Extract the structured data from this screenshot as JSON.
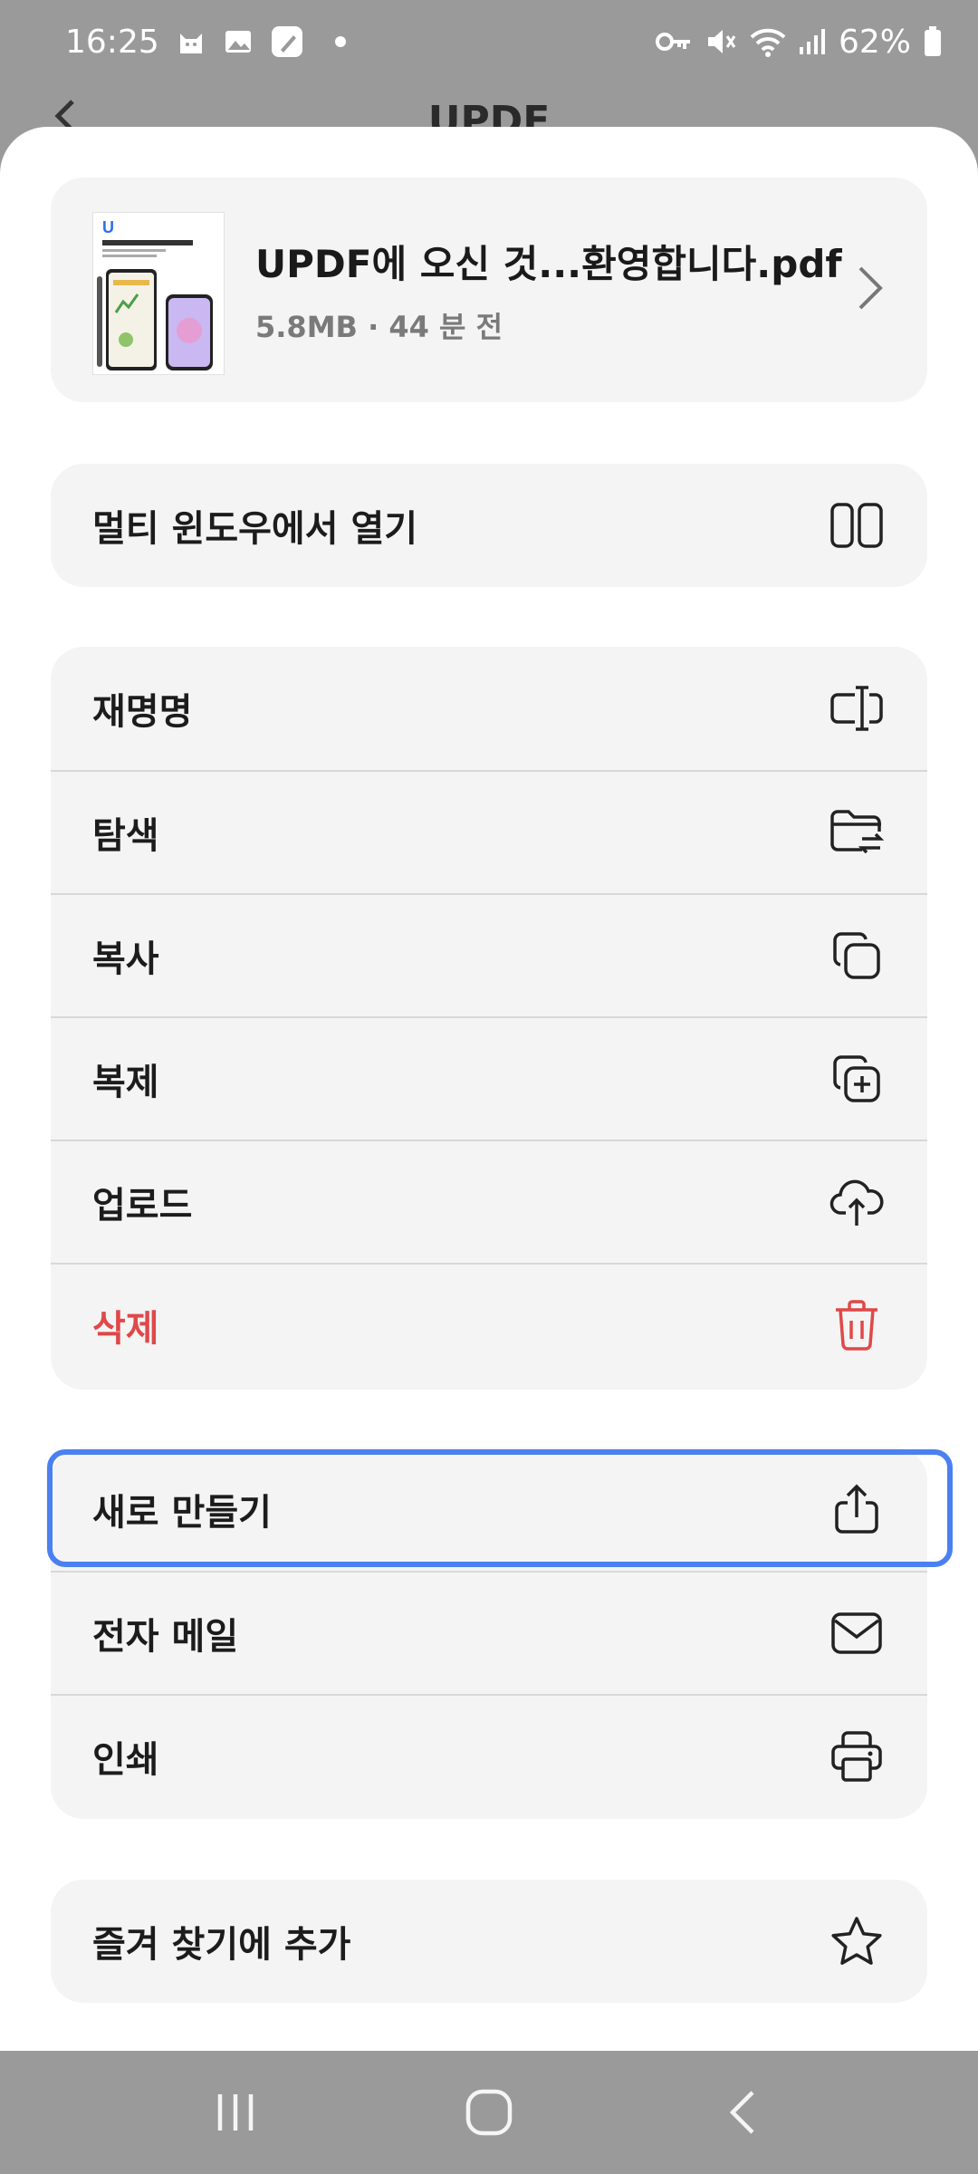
{
  "status_bar": {
    "time": "16:25",
    "battery": "62%",
    "left_icons": [
      "cat-notification-icon",
      "gallery-notification-icon",
      "notes-notification-icon"
    ],
    "right_icons": [
      "vpn-key-icon",
      "mute-icon",
      "wifi-icon",
      "signal-icon",
      "battery-icon"
    ]
  },
  "background_app": {
    "title": "UPDF"
  },
  "file": {
    "name": "UPDF에 오신 것...환영합니다.pdf",
    "size": "5.8MB",
    "separator": "·",
    "time": "44 분 전",
    "thumbnail_logo": "U",
    "thumbnail_title": "UPDF에 오신 것을 환영합니다"
  },
  "multi_window": {
    "label": "멀티 윈도우에서 열기",
    "icon": "multi-window-icon"
  },
  "actions": [
    {
      "label": "재명명",
      "icon": "rename-icon"
    },
    {
      "label": "탐색",
      "icon": "folder-move-icon"
    },
    {
      "label": "복사",
      "icon": "copy-icon"
    },
    {
      "label": "복제",
      "icon": "duplicate-icon"
    },
    {
      "label": "업로드",
      "icon": "cloud-upload-icon"
    },
    {
      "label": "삭제",
      "icon": "trash-icon",
      "color": "#e04848"
    }
  ],
  "share": [
    {
      "label": "새로 만들기",
      "icon": "share-icon"
    },
    {
      "label": "전자 메일",
      "icon": "mail-icon"
    },
    {
      "label": "인쇄",
      "icon": "printer-icon"
    }
  ],
  "favorite": {
    "label": "즐겨 찾기에 추가",
    "icon": "star-icon"
  },
  "colors": {
    "highlight": "#4a80f0",
    "danger": "#e04848",
    "card_bg": "#f4f4f4"
  }
}
